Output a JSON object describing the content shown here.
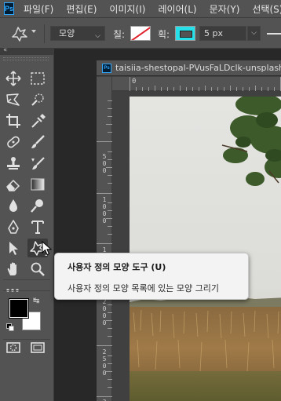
{
  "app": {
    "logo_text": "Ps",
    "accent_color": "#31a8ff"
  },
  "menu": [
    "파일(F)",
    "편집(E)",
    "이미지(I)",
    "레이어(L)",
    "문자(Y)",
    "선택(S)"
  ],
  "options_bar": {
    "shape_mode": "모양",
    "fill_label": "칠:",
    "stroke_label": "획:",
    "stroke_width": "5 px",
    "stroke_color": "#25e0e8",
    "fill_color": "none"
  },
  "document": {
    "tab_title": "taisiia-shestopal-PVusFaLDclk-unsplash",
    "ruler_h": [
      "0",
      "1"
    ],
    "ruler_v": [
      {
        "digits": [
          "5",
          "0",
          "0"
        ]
      },
      {
        "digits": [
          "1",
          "0",
          "0",
          "0"
        ]
      },
      {
        "digits": [
          "1",
          "5",
          "0",
          "0"
        ]
      },
      {
        "digits": [
          "2",
          "0",
          "0",
          "0"
        ]
      },
      {
        "digits": [
          "2",
          "5",
          "0",
          "0"
        ]
      },
      {
        "digits": [
          "3"
        ]
      }
    ]
  },
  "tooltip": {
    "title": "사용자 정의 모양 도구 (U)",
    "description": "사용자 정의 모양 목록에 있는 모양 그리기"
  },
  "colors": {
    "foreground": "#000000",
    "background": "#ffffff"
  },
  "tools": [
    "move-tool-icon",
    "marquee-tool-icon",
    "lasso-tool-icon",
    "quick-selection-tool-icon",
    "crop-tool-icon",
    "eyedropper-tool-icon",
    "healing-brush-tool-icon",
    "brush-tool-icon",
    "clone-stamp-tool-icon",
    "history-brush-tool-icon",
    "eraser-tool-icon",
    "gradient-tool-icon",
    "blur-tool-icon",
    "dodge-tool-icon",
    "pen-tool-icon",
    "type-tool-icon",
    "path-selection-tool-icon",
    "custom-shape-tool-icon",
    "hand-tool-icon",
    "zoom-tool-icon",
    "more-tools-icon",
    "default-colors-icon",
    "swap-colors-icon",
    "quick-mask-icon",
    "screen-mode-icon"
  ]
}
